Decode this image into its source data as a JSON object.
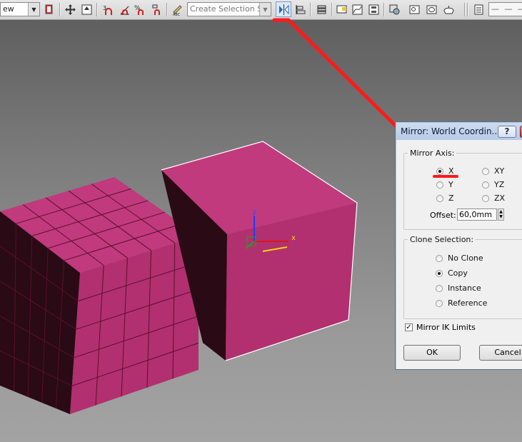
{
  "toolbar": {
    "view_combo": "ew",
    "selection_set_placeholder": "Create Selection Se",
    "icons": [
      "select-link-icon",
      "move-icon",
      "place-icon",
      "snap-3-icon",
      "angle-snap-icon",
      "percent-snap-icon",
      "spinner-snap-icon",
      "edit-named-selection-icon",
      "mirror-icon",
      "align-icon",
      "layer-manager-icon",
      "toggle-ribbon-icon",
      "curve-editor-icon",
      "schematic-view-icon",
      "material-editor-icon",
      "render-setup-icon",
      "rendered-frame-icon",
      "render-icon",
      "layers-icon"
    ]
  },
  "dialog": {
    "title": "Mirror: World Coordin...",
    "help_label": "?",
    "mirror_axis_label": "Mirror Axis:",
    "axes": [
      {
        "label": "X",
        "selected": true
      },
      {
        "label": "XY",
        "selected": false
      },
      {
        "label": "Y",
        "selected": false
      },
      {
        "label": "YZ",
        "selected": false
      },
      {
        "label": "Z",
        "selected": false
      },
      {
        "label": "ZX",
        "selected": false
      }
    ],
    "offset_label": "Offset:",
    "offset_value": "60,0mm",
    "clone_selection_label": "Clone Selection:",
    "clone_options": [
      {
        "label": "No Clone",
        "selected": false
      },
      {
        "label": "Copy",
        "selected": true
      },
      {
        "label": "Instance",
        "selected": false
      },
      {
        "label": "Reference",
        "selected": false
      }
    ],
    "mirror_ik_label": "Mirror IK Limits",
    "mirror_ik_checked": true,
    "ok_label": "OK",
    "cancel_label": "Cancel"
  },
  "gizmo": {
    "z_label": "z",
    "x_label": "x"
  },
  "colors": {
    "box_front": "#b2306f",
    "box_top": "#c13a7d",
    "box_side": "#2a0a14",
    "annotation": "#ff1a1a"
  }
}
